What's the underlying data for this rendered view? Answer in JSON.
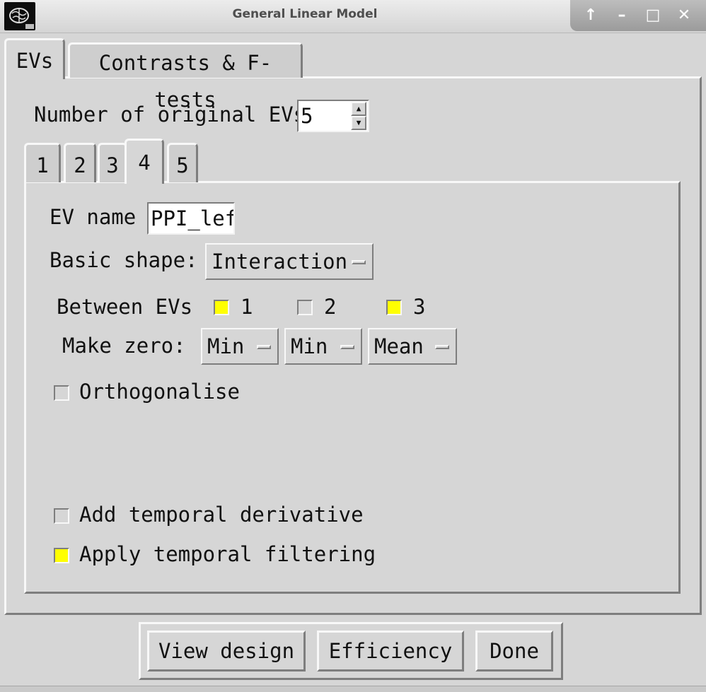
{
  "window": {
    "title": "General Linear Model",
    "controls": [
      "maximize-up-icon",
      "minimize-icon",
      "restore-icon",
      "close-icon"
    ]
  },
  "tabs": [
    {
      "label": "EVs",
      "active": true
    },
    {
      "label": "Contrasts & F-tests",
      "active": false
    }
  ],
  "num_evs": {
    "label": "Number of original EVs",
    "value": "5"
  },
  "ev_tabs": [
    "1",
    "2",
    "3",
    "4",
    "5"
  ],
  "active_ev_tab": "4",
  "ev": {
    "name_label": "EV name",
    "name_value": "PPI_lef",
    "shape_label": "Basic shape:",
    "shape_value": "Interaction",
    "between_label": "Between EVs",
    "between": [
      {
        "label": "1",
        "checked": true
      },
      {
        "label": "2",
        "checked": false
      },
      {
        "label": "3",
        "checked": true
      }
    ],
    "make_zero_label": "Make zero:",
    "make_zero": [
      "Min",
      "Min",
      "Mean"
    ],
    "orthogonalise": {
      "label": "Orthogonalise",
      "checked": false
    },
    "temporal_derivative": {
      "label": "Add temporal derivative",
      "checked": false
    },
    "temporal_filtering": {
      "label": "Apply temporal filtering",
      "checked": true
    }
  },
  "buttons": {
    "view_design": "View design",
    "efficiency": "Efficiency",
    "done": "Done"
  },
  "colors": {
    "checked": "#ffff00",
    "background": "#d6d6d6"
  }
}
